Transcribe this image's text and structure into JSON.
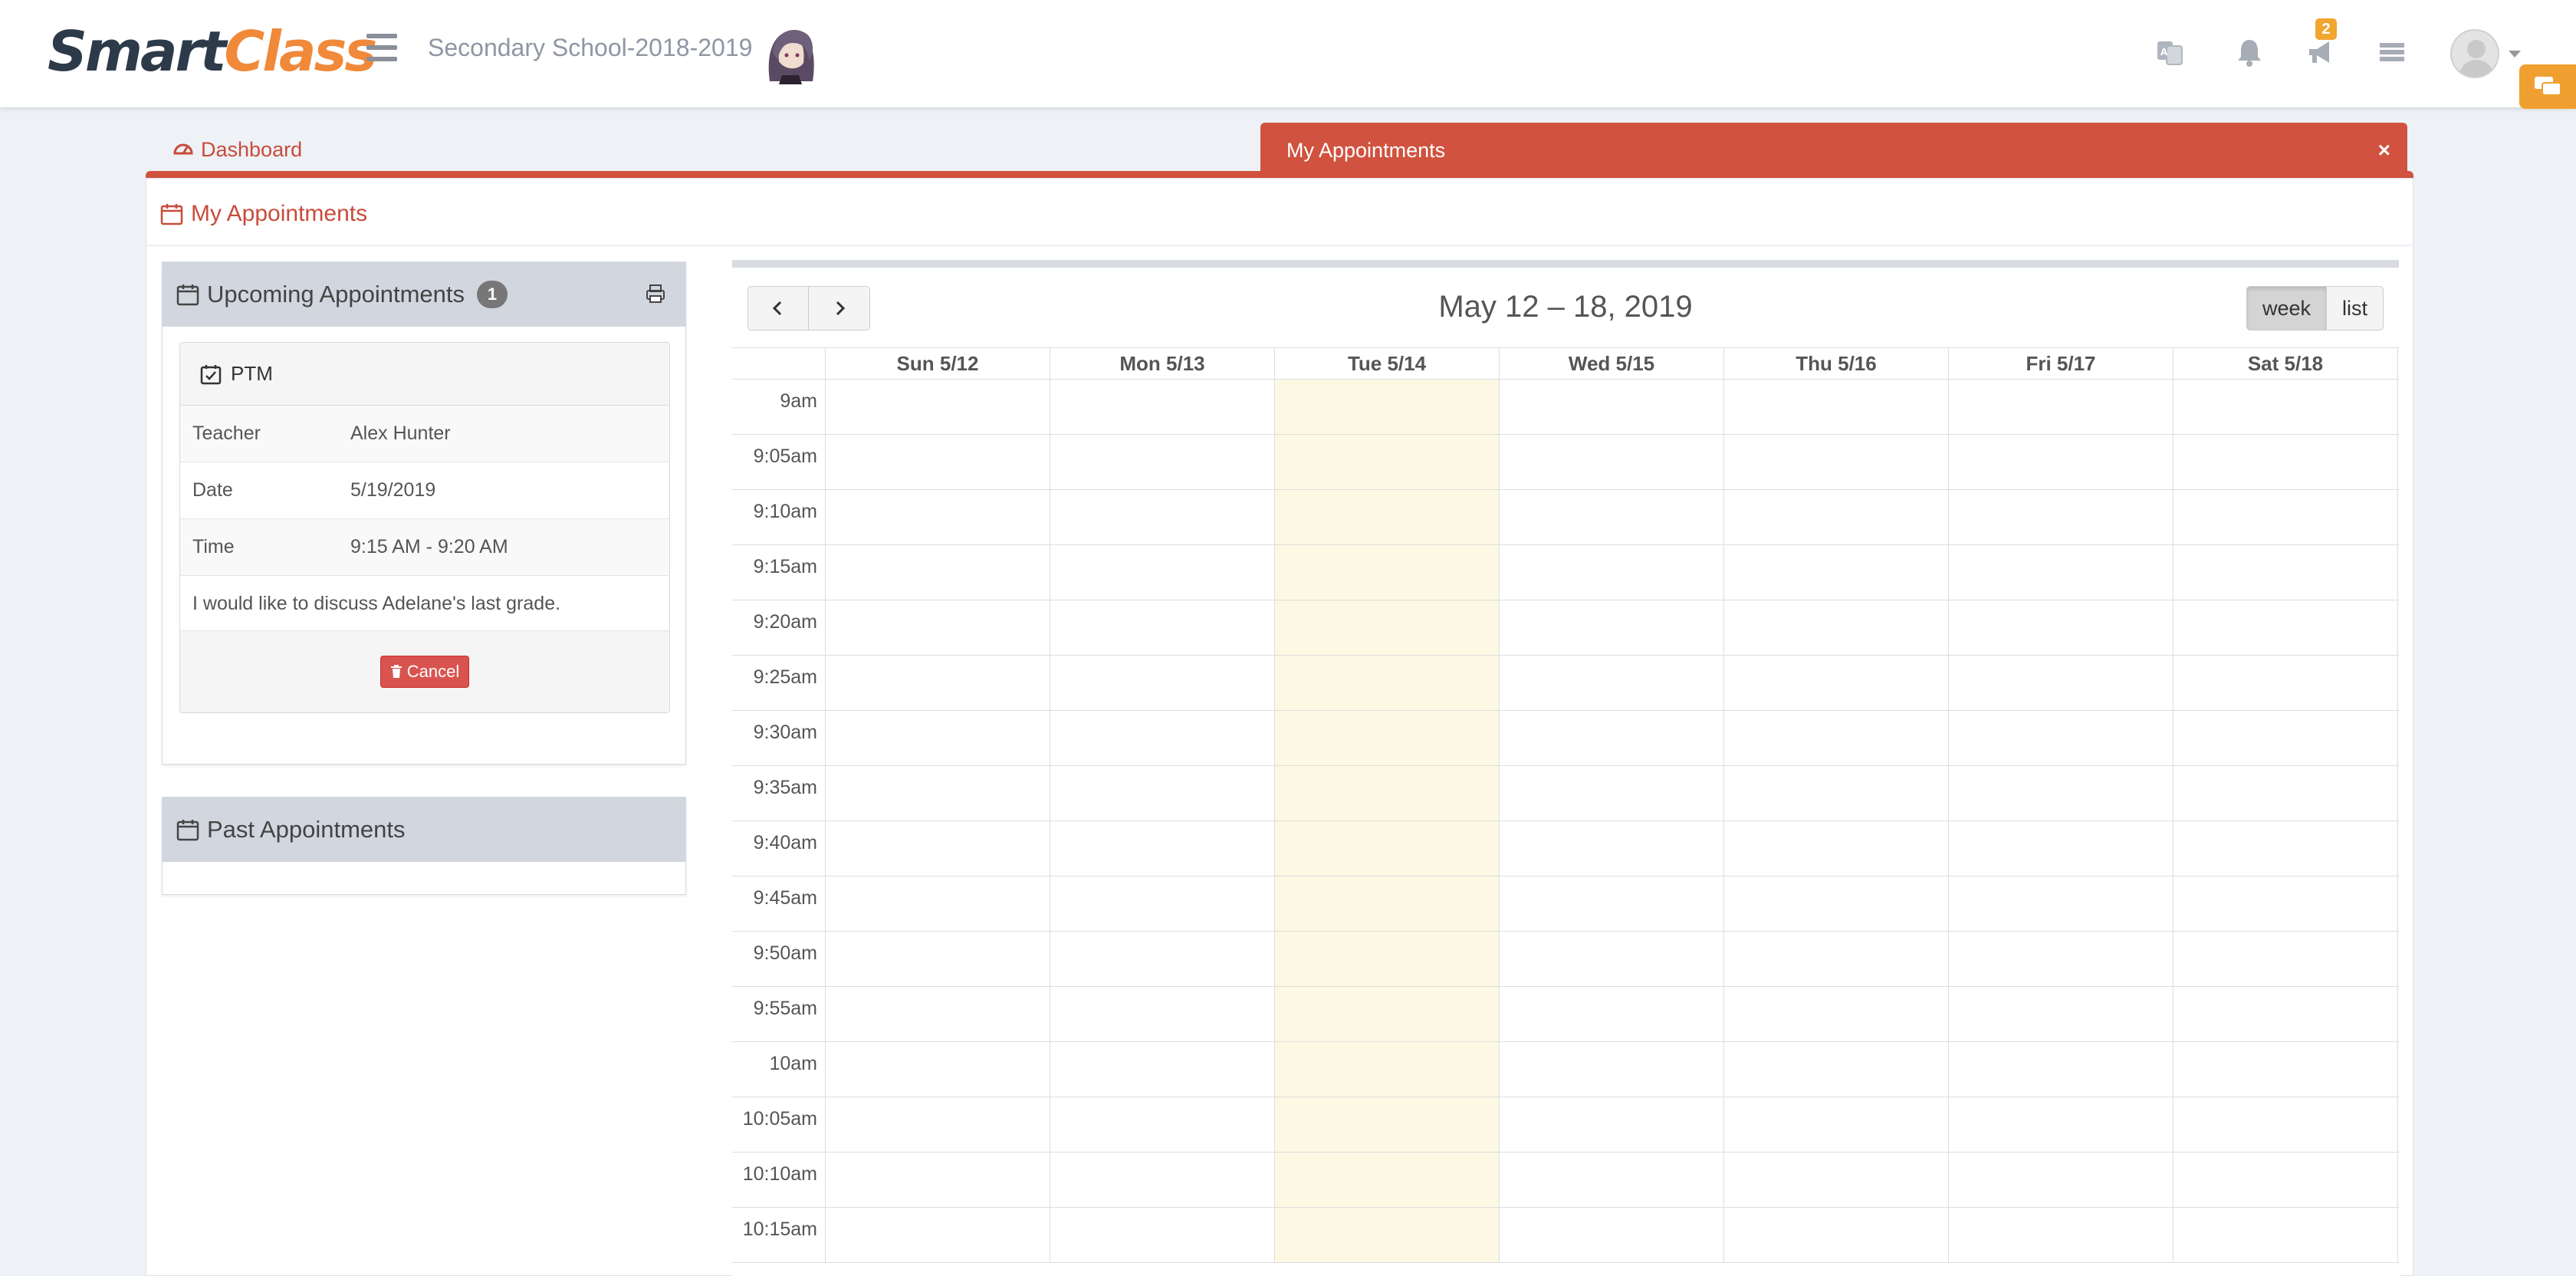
{
  "brand": {
    "part1": "Smart",
    "part2": "Class"
  },
  "header": {
    "school": "Secondary School-2018-2019",
    "notification_count": "2"
  },
  "tabs": {
    "dashboard": "Dashboard",
    "active": "My Appointments",
    "close": "×"
  },
  "page": {
    "title": "My Appointments"
  },
  "upcoming": {
    "title": "Upcoming Appointments",
    "count": "1",
    "appointment": {
      "type": "PTM",
      "rows": [
        {
          "key": "Teacher",
          "value": "Alex Hunter"
        },
        {
          "key": "Date",
          "value": "5/19/2019"
        },
        {
          "key": "Time",
          "value": "9:15 AM - 9:20 AM"
        }
      ],
      "note": "I would like to discuss Adelane's last grade.",
      "cancel_label": "Cancel"
    }
  },
  "past": {
    "title": "Past Appointments"
  },
  "calendar": {
    "title": "May 12 – 18, 2019",
    "views": {
      "week": "week",
      "list": "list"
    },
    "days": [
      "Sun 5/12",
      "Mon 5/13",
      "Tue 5/14",
      "Wed 5/15",
      "Thu 5/16",
      "Fri 5/17",
      "Sat 5/18"
    ],
    "today_index": 2,
    "times": [
      "9am",
      "9:05am",
      "9:10am",
      "9:15am",
      "9:20am",
      "9:25am",
      "9:30am",
      "9:35am",
      "9:40am",
      "9:45am",
      "9:50am",
      "9:55am",
      "10am",
      "10:05am",
      "10:10am",
      "10:15am"
    ]
  },
  "colors": {
    "accent": "#d0523f",
    "brand_orange": "#f0893a",
    "today_bg": "#fcf8e3"
  }
}
